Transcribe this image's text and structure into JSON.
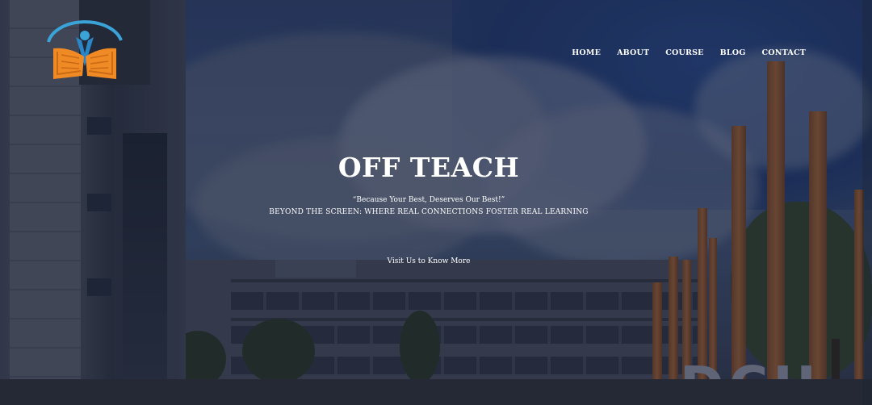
{
  "brand": {
    "logo_icon": "book-person-logo-icon",
    "accent_colors": [
      "#3aa3d8",
      "#f08a24"
    ]
  },
  "nav": {
    "items": [
      {
        "label": "HOME"
      },
      {
        "label": "ABOUT"
      },
      {
        "label": "COURSE"
      },
      {
        "label": "BLOG"
      },
      {
        "label": "CONTACT"
      }
    ]
  },
  "hero": {
    "title": "OFF TEACH",
    "quote": "“Because Your Best, Deserves Our Best!”",
    "tagline": "BEYOND THE SCREEN: WHERE REAL CONNECTIONS FOSTER REAL LEARNING",
    "cta_label": "Visit Us to Know More",
    "background_sign": "DCU"
  }
}
